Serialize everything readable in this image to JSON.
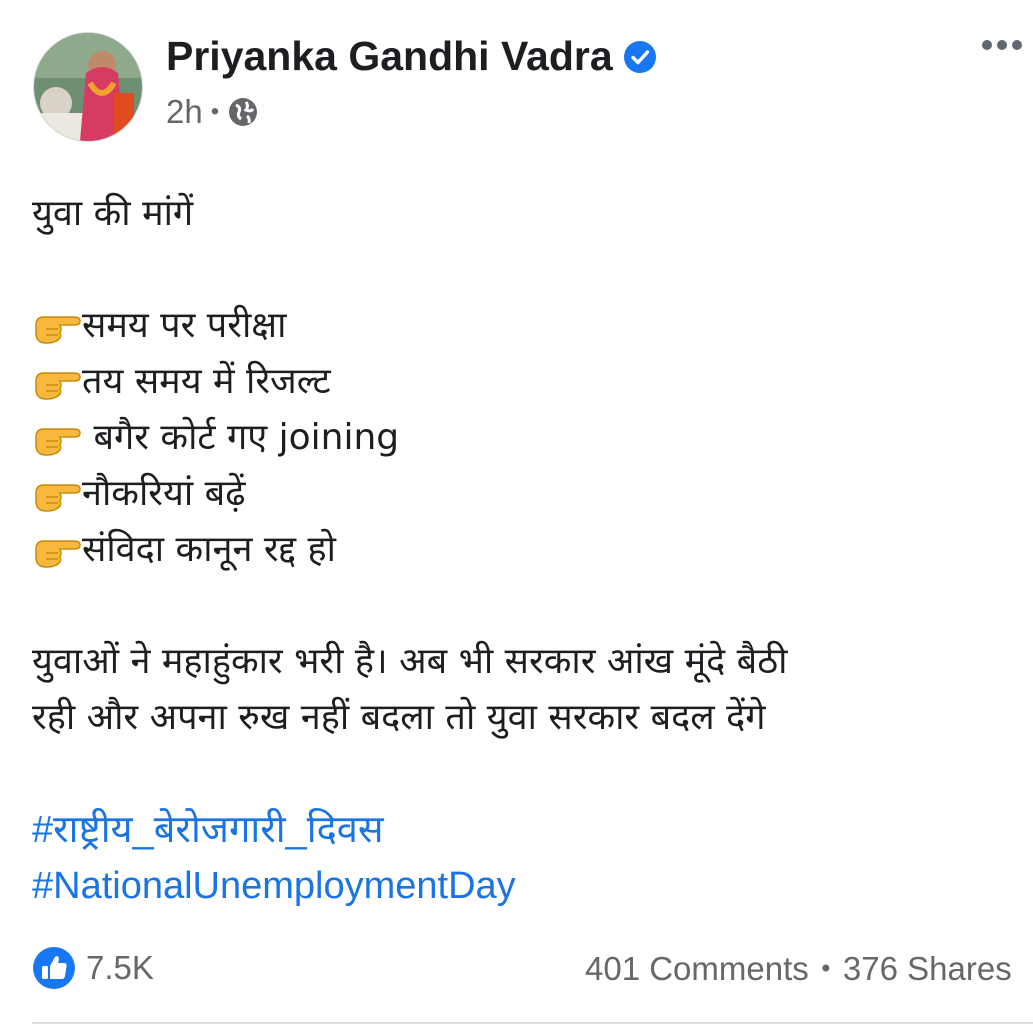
{
  "post": {
    "author": "Priyanka Gandhi Vadra",
    "time": "2h",
    "separator": "•",
    "audience_icon": "globe-icon",
    "verified_icon": "verified-badge-icon",
    "more_icon": "more-options-icon",
    "title": "युवा की मांगें",
    "demands": [
      "समय पर परीक्षा",
      "तय समय में रिजल्ट",
      " बगैर कोर्ट गए joining",
      "नौकरियां बढ़ें",
      "संविदा कानून रद्द हो"
    ],
    "bullet_icon": "pointing-hand-icon",
    "body_line_1": "युवाओं ने महाहुंकार भरी है। अब भी सरकार आंख मूंदे बैठी",
    "body_line_2": "रही और अपना रुख नहीं बदला तो युवा सरकार बदल देंगे",
    "hashtags": [
      "#राष्ट्रीय_बेरोजगारी_दिवस",
      "#NationalUnemploymentDay"
    ]
  },
  "engagement": {
    "like_icon": "like-icon",
    "likes": "7.5K",
    "comments": "401 Comments",
    "separator": "•",
    "shares": "376 Shares"
  },
  "colors": {
    "link": "#1b74e4",
    "verified": "#1877f2",
    "secondary_text": "#65676b",
    "primary_text": "#1c1e21",
    "bullet_hand": "#f6b93b"
  }
}
